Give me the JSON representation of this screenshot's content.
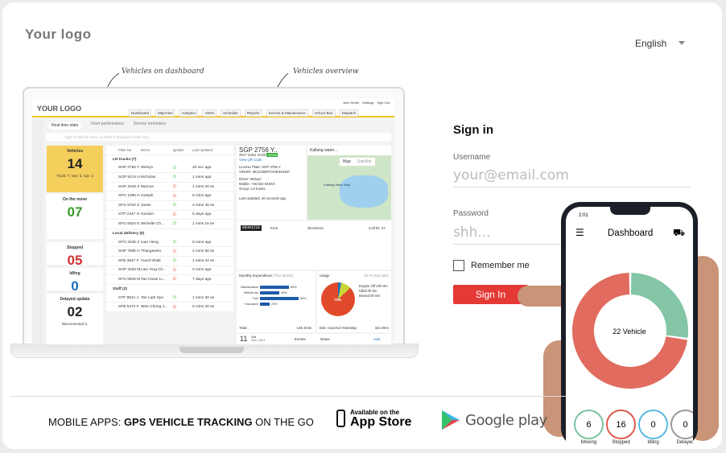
{
  "logo": "Your logo",
  "language": "English",
  "annotations": {
    "dashboard": "Vehicles on dashboard",
    "overview": "Vehicles overview"
  },
  "screen": {
    "logo": "YOUR LOGO",
    "user": "John Smith",
    "settings": "Settings",
    "signout": "Sign Out",
    "nav": [
      "Dashboard",
      "MapView",
      "Analytics",
      "Alerts",
      "Schedule",
      "Reports",
      "Service & Maintenance",
      "School Bus",
      "Dispatch"
    ],
    "subtabs": [
      "Real time stats",
      "Fleet performance",
      "Service reminders"
    ],
    "search_placeholder": "Type in Vehicle name or Plate # and press Enter key...",
    "tiles": [
      {
        "title": "Vehicles",
        "count": "14",
        "sub": "Truck: 7, Van: 5, Car: 2",
        "color": "#222"
      },
      {
        "title": "On the move",
        "count": "07",
        "sub": "",
        "color": "#3a9a2a"
      },
      {
        "title": "Stopped",
        "count": "05",
        "sub": "",
        "color": "#d32f2f"
      },
      {
        "title": "Idling",
        "count": "0",
        "sub": "",
        "color": "#1e6fc0"
      },
      {
        "title": "Delayed update",
        "count": "02",
        "sub": "Disconnected 2,",
        "color": "#222"
      }
    ],
    "columns": [
      "Plate No",
      "Driver",
      "Ignition",
      "Last Updated"
    ],
    "groups": [
      {
        "name": "LH trucks (7)",
        "rows": [
          [
            "SNP 2756 Y",
            "Melvyn",
            "on",
            "20 sec ago"
          ],
          [
            "SGP 5214 H",
            "Nicholas",
            "on",
            "1 mins ago"
          ],
          [
            "SGP 2045 Z",
            "Marcus",
            "off",
            "1 mins 20 se"
          ],
          [
            "SFG 1385 H",
            "Joseph",
            "off",
            "6 mins ago"
          ],
          [
            "SFG 6752 Z",
            "Javier",
            "on",
            "3 mins 45 se"
          ],
          [
            "STP 2447 H",
            "Gordon",
            "off",
            "5 days ago"
          ],
          [
            "SFG 6534 E",
            "Michelle Ch...",
            "on",
            "1 mins 15 se"
          ]
        ]
      },
      {
        "name": "Local delivery (5)",
        "rows": [
          [
            "SFG 2045 Z",
            "Ivan Heng",
            "on",
            "5 mins ago"
          ],
          [
            "SNP 7585 H",
            "Thangavelu",
            "off",
            "2 mins 50 se"
          ],
          [
            "SFB 3547 F",
            "Yusof Ishak",
            "on",
            "1 mins 44 se"
          ],
          [
            "SGP 3252 M",
            "Lien Ying Ch...",
            "off",
            "3 mins ago"
          ],
          [
            "SFG 8945 M",
            "Tan Howe Li...",
            "off",
            "7 days ago"
          ]
        ]
      },
      {
        "name": "Staff (2)",
        "rows": [
          [
            "STP 8541 J",
            "Tan Lark Sye",
            "on",
            "1 mins 30 se"
          ],
          [
            "SFB 5472 F",
            "Wee Chong J...",
            "off",
            "5 mins 20 se"
          ]
        ]
      }
    ],
    "vehicle": {
      "plate": "SGP 2756 Y..",
      "model": "2017 Volvo XC90",
      "status": "Active",
      "qr": "View QR Code",
      "license": "License Plate: SGP 2756 Y",
      "vin": "VIN/SN: MC2A5ERTOHE325487",
      "driver": "Driver: Melvyn",
      "mobile": "Mobile: +65 822 845XX",
      "group": "Group: LH trucks",
      "updated": "Last Updated: 20 seconds ago",
      "odometer": "00301218",
      "odo_unit": "Kms",
      "fuel": "30.0Litres",
      "cell": "Cell ID: 47"
    },
    "map": {
      "location": "Kallang water...",
      "map": "Map",
      "satellite": "Satellite",
      "place": "Kallang Wave Mall"
    },
    "expenditure": {
      "title": "Monthly Expenditure",
      "period": "(This Month)",
      "items": [
        [
          "Maintenance",
          60
        ],
        [
          "Vehicle tax",
          40
        ],
        [
          "Fuel",
          80
        ],
        [
          "Insurance",
          20
        ]
      ],
      "total_label": "Total :",
      "total": "135 SGD"
    },
    "usage": {
      "title": "Usage",
      "date": "10 Fri Sep 2021",
      "legend": [
        "Engine Off 24h 0m",
        "Idled 0h 0m",
        "Moved 0h 0m"
      ],
      "pct": "73%",
      "dist_label": "Dist. Covered Yesterday",
      "dist": "321.0Km"
    },
    "footer": {
      "day": "11",
      "dow": "Sat",
      "month": "Sep, 2021",
      "events": "Events",
      "notes": "Notes",
      "add": "Add"
    }
  },
  "signin": {
    "title": "Sign in",
    "username_label": "Username",
    "username_placeholder": "your@email.com",
    "password_label": "Password",
    "password_placeholder": "shh...",
    "remember": "Remember me",
    "button": "Sign In"
  },
  "phone": {
    "time": "2:01",
    "title": "Dashboard",
    "center": "22 Vehicle",
    "counts": [
      {
        "value": "6",
        "label": "Moving",
        "color": "#7cc3a0"
      },
      {
        "value": "16",
        "label": "Stopped",
        "color": "#e05a4e"
      },
      {
        "value": "0",
        "label": "Idling",
        "color": "#5bb8e0"
      },
      {
        "value": "0",
        "label": "Delayed",
        "color": "#999"
      }
    ],
    "chart": {
      "moving": 6,
      "stopped": 16
    }
  },
  "promo": {
    "prefix": "MOBILE APPS: ",
    "bold": "GPS VEHICLE TRACKING",
    "suffix": " ON THE GO",
    "appstore_small": "Available on the",
    "appstore": "App Store",
    "googleplay": "Google play"
  },
  "colors": {
    "accent": "#e53935",
    "highlight": "#f5c518"
  }
}
